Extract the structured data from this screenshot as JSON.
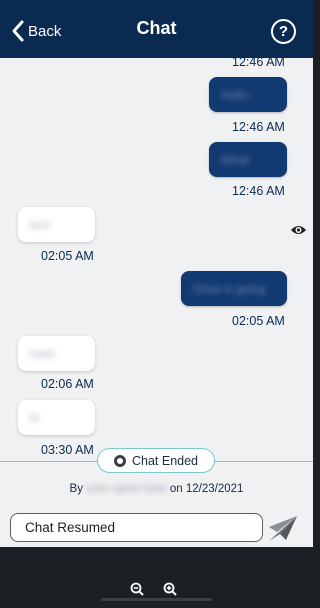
{
  "header": {
    "back_label": "Back",
    "title": "Chat",
    "help_symbol": "?",
    "background_color": "#0b2a52"
  },
  "messages": [
    {
      "direction": "out",
      "text": "Hello",
      "time": "12:46 AM"
    },
    {
      "direction": "out",
      "text": "What",
      "time": "12:46 AM"
    },
    {
      "direction": "in",
      "text": "test",
      "time": "02:05 AM"
    },
    {
      "direction": "out",
      "text": "Drive is going",
      "time": "02:05 AM",
      "seen_icon": "eye-icon"
    },
    {
      "direction": "in",
      "text": "hello",
      "time": "02:06 AM"
    },
    {
      "direction": "in",
      "text": "hi",
      "time": "03:30 AM"
    }
  ],
  "top_partial_time": "12:46 AM",
  "chat_ended": {
    "label": "Chat Ended",
    "by_prefix": "By",
    "by_name": "user name here",
    "date_text": "on 12/23/2021"
  },
  "composer": {
    "value": "Chat Resumed",
    "placeholder": "",
    "send_icon": "send-icon"
  },
  "bottom_bar": {
    "zoom_out_icon": "zoom-out-icon",
    "zoom_in_icon": "zoom-in-icon"
  },
  "colors": {
    "outgoing_bubble": "#123a72",
    "incoming_bubble": "#ffffff",
    "divider": "#7fc8c8",
    "chat_background": "#f0f1f3"
  }
}
